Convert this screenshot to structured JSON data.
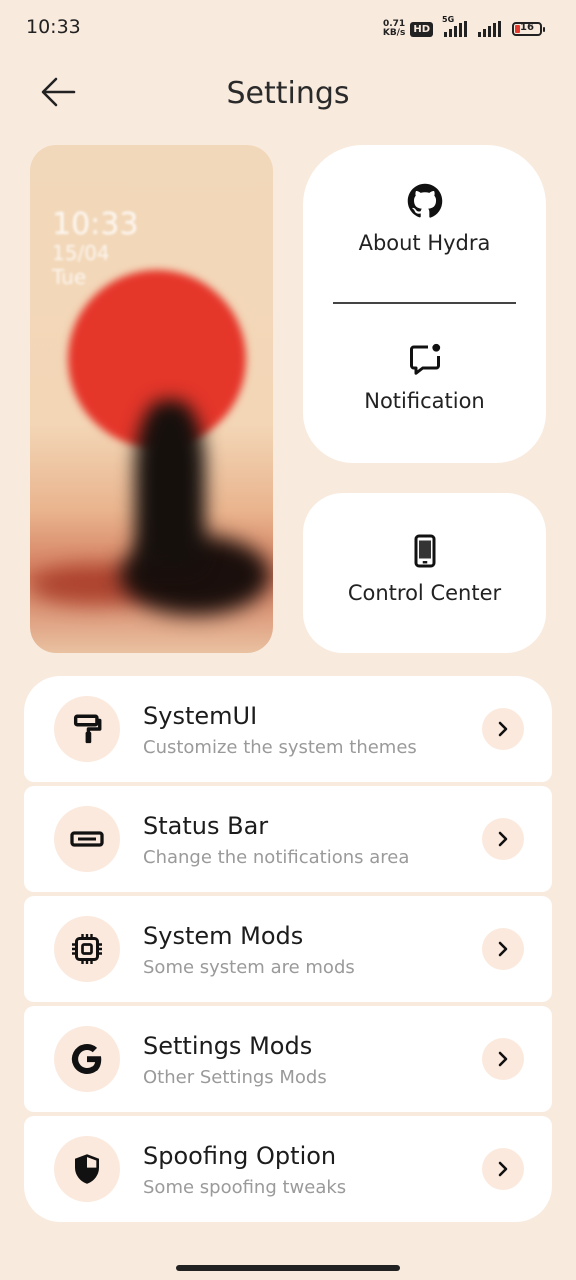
{
  "status_bar": {
    "time": "10:33",
    "net_speed_value": "0.71",
    "net_speed_unit": "KB/s",
    "hd_badge": "HD",
    "network_type": "5G",
    "battery_level": "16"
  },
  "header": {
    "title": "Settings"
  },
  "wallpaper_preview": {
    "time": "10:33",
    "date": "15/04",
    "day": "Tue"
  },
  "quick_cards": {
    "about": {
      "label": "About Hydra",
      "icon": "github-icon"
    },
    "notification": {
      "label": "Notification",
      "icon": "message-badge-icon"
    },
    "control_center": {
      "label": "Control Center",
      "icon": "phone-icon"
    }
  },
  "menu": {
    "items": [
      {
        "title": "SystemUI",
        "subtitle": "Customize the system themes",
        "icon": "paint-roller-icon"
      },
      {
        "title": "Status Bar",
        "subtitle": "Change the notifications area",
        "icon": "status-bar-icon"
      },
      {
        "title": "System Mods",
        "subtitle": "Some system are mods",
        "icon": "chip-icon"
      },
      {
        "title": "Settings Mods",
        "subtitle": "Other Settings Mods",
        "icon": "google-g-icon"
      },
      {
        "title": "Spoofing Option",
        "subtitle": "Some spoofing tweaks",
        "icon": "shield-icon"
      }
    ]
  },
  "colors": {
    "background": "#f9eade",
    "card": "#ffffff",
    "icon_bg": "#fbe9dd",
    "battery_low": "#e43a2f"
  }
}
